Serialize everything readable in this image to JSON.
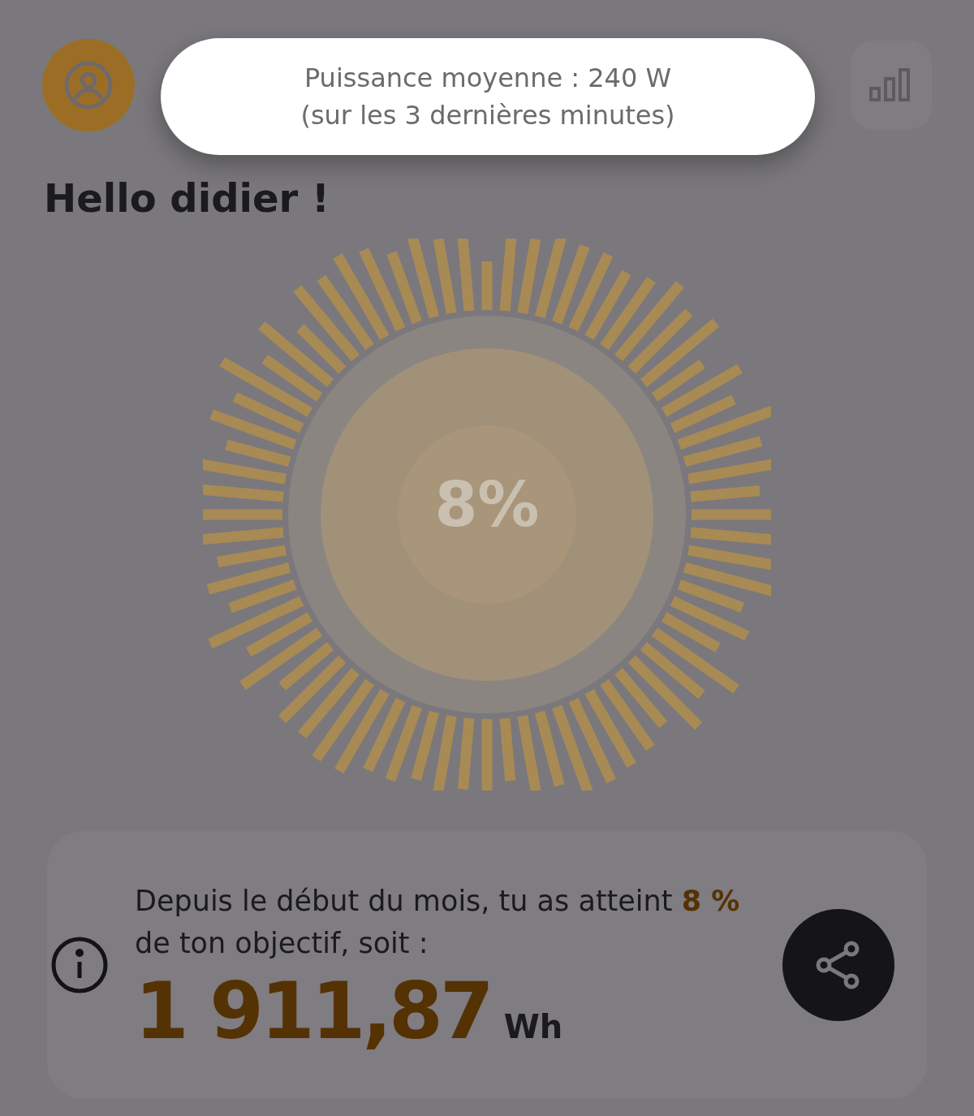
{
  "toast": {
    "lines": [
      "Puissance moyenne : 240 W",
      "(sur les 3 dernières minutes)"
    ]
  },
  "greeting": "Hello didier !",
  "gauge": {
    "percent": "8%"
  },
  "summary": {
    "text_before": "Depuis le début du mois, tu as atteint ",
    "highlight": "8 %",
    "text_after": " de ton objectif, soit :",
    "value": "1 911,87",
    "unit": "Wh"
  }
}
